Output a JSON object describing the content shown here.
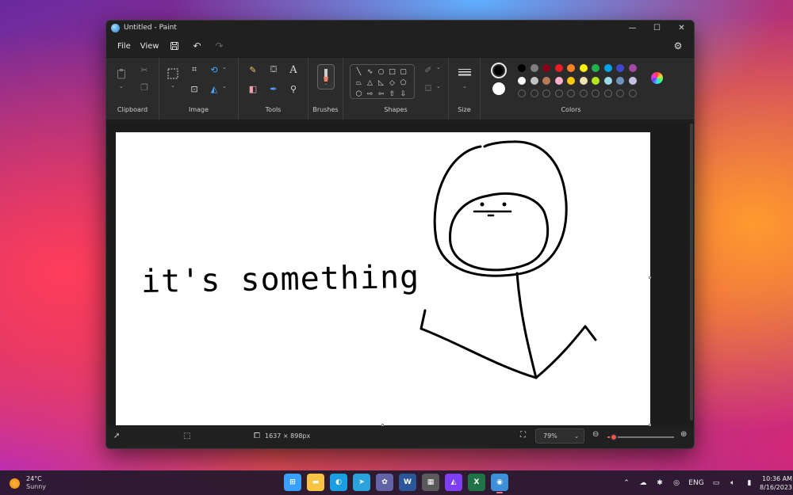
{
  "window": {
    "title": "Untitled - Paint",
    "controls": {
      "minimize": "—",
      "maximize": "☐",
      "close": "✕"
    }
  },
  "menu": {
    "file": "File",
    "view": "View",
    "icons": [
      "save-icon",
      "undo-icon",
      "redo-icon",
      "gear-icon"
    ]
  },
  "ribbon": {
    "groups": [
      "Clipboard",
      "Image",
      "Tools",
      "Brushes",
      "Shapes",
      "Size",
      "Colors"
    ],
    "tools": [
      "pencil-icon",
      "fill-icon",
      "text-icon",
      "eraser-icon",
      "color-picker-icon",
      "magnifier-icon"
    ],
    "text_tool_glyph": "A"
  },
  "colors": {
    "primary": "#000000",
    "secondary": "#ffffff",
    "palette_row1": [
      "#000000",
      "#7f7f7f",
      "#880015",
      "#ed1c24",
      "#ff7f27",
      "#fff200",
      "#22b14c",
      "#00a2e8",
      "#3f48cc",
      "#a349a4"
    ],
    "palette_row2": [
      "#ffffff",
      "#c3c3c3",
      "#b97a57",
      "#ffaec9",
      "#ffc90e",
      "#efe4b0",
      "#b5e61d",
      "#99d9ea",
      "#7092be",
      "#c8bfe7"
    ],
    "custom_slots": 10
  },
  "canvas": {
    "drawing_text": "it's something"
  },
  "status": {
    "dimensions": "1637 × 898px",
    "zoom": "79%",
    "zoom_level": 0.1
  },
  "taskbar": {
    "weather_temp": "24°C",
    "weather_desc": "Sunny",
    "language": "ENG",
    "time": "10:36 AM",
    "date": "8/16/2023",
    "notifications": "1",
    "apps": [
      {
        "name": "start-icon",
        "glyph": "⊞",
        "color": "#3aa0ff"
      },
      {
        "name": "file-explorer-icon",
        "glyph": "▬",
        "color": "#f6c343"
      },
      {
        "name": "edge-icon",
        "glyph": "◐",
        "color": "#1b9de2"
      },
      {
        "name": "telegram-icon",
        "glyph": "➤",
        "color": "#2aa3dd"
      },
      {
        "name": "teams-icon",
        "glyph": "✿",
        "color": "#6264a7"
      },
      {
        "name": "word-icon",
        "glyph": "W",
        "color": "#2b579a"
      },
      {
        "name": "calculator-icon",
        "glyph": "▦",
        "color": "#5a5a5a"
      },
      {
        "name": "affinity-icon",
        "glyph": "◭",
        "color": "#7e3ff2"
      },
      {
        "name": "excel-icon",
        "glyph": "X",
        "color": "#1f7346"
      },
      {
        "name": "paint-icon",
        "glyph": "◉",
        "color": "#3d8fd8"
      }
    ]
  }
}
